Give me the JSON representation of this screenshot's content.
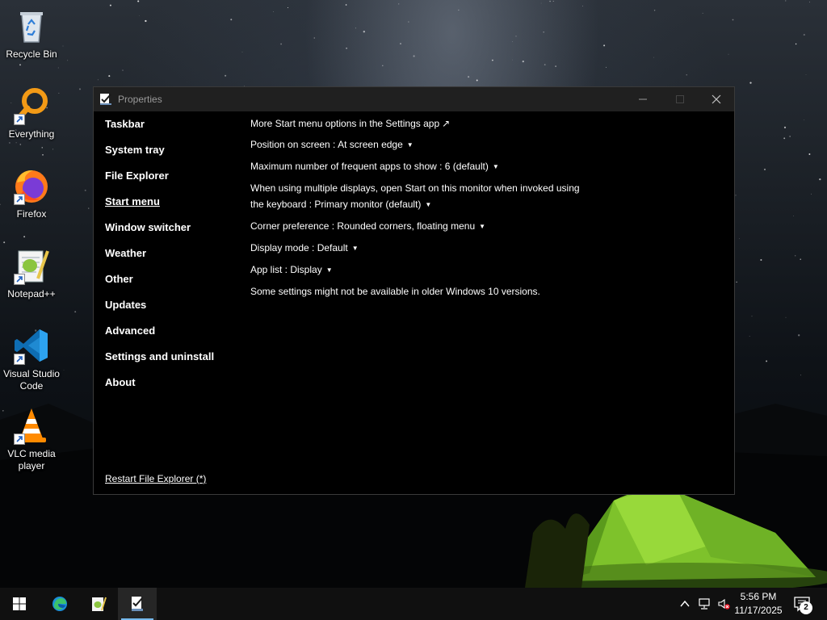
{
  "desktop": {
    "icons": [
      {
        "id": "recycle-bin",
        "label": "Recycle Bin",
        "icon": "recycle-bin-icon",
        "shortcut": false
      },
      {
        "id": "everything",
        "label": "Everything",
        "icon": "everything-search-icon",
        "shortcut": true
      },
      {
        "id": "firefox",
        "label": "Firefox",
        "icon": "firefox-icon",
        "shortcut": true
      },
      {
        "id": "notepadpp",
        "label": "Notepad++",
        "icon": "notepad-plus-plus-icon",
        "shortcut": true
      },
      {
        "id": "vscode",
        "label": "Visual Studio Code",
        "icon": "vscode-icon",
        "shortcut": true
      },
      {
        "id": "vlc",
        "label": "VLC media player",
        "icon": "vlc-icon",
        "shortcut": true
      }
    ]
  },
  "window": {
    "title": "Properties",
    "nav": [
      {
        "label": "Taskbar",
        "active": false
      },
      {
        "label": "System tray",
        "active": false
      },
      {
        "label": "File Explorer",
        "active": false
      },
      {
        "label": "Start menu",
        "active": true
      },
      {
        "label": "Window switcher",
        "active": false
      },
      {
        "label": "Weather",
        "active": false
      },
      {
        "label": "Other",
        "active": false
      },
      {
        "label": "Updates",
        "active": false
      },
      {
        "label": "Advanced",
        "active": false
      },
      {
        "label": "Settings and uninstall",
        "active": false
      },
      {
        "label": "About",
        "active": false
      }
    ],
    "restart_link": "Restart File Explorer (*)",
    "settings": {
      "more_options": "More Start menu options in the Settings app",
      "more_options_glyph": "↗",
      "position": "Position on screen : At screen edge",
      "frequent_apps": "Maximum number of frequent apps to show : 6 (default)",
      "multi_display_line1": "When using multiple displays, open Start on this monitor when invoked using",
      "multi_display_line2": "the keyboard : Primary monitor (default)",
      "corner": "Corner preference : Rounded corners, floating menu",
      "display_mode": "Display mode : Default",
      "app_list": "App list : Display",
      "note": "Some settings might not be available in older Windows 10 versions.",
      "caret": "▼"
    }
  },
  "taskbar": {
    "clock_time": "5:56 PM",
    "clock_date": "11/17/2025",
    "notification_count": "2",
    "accent": "#76b9ed"
  }
}
